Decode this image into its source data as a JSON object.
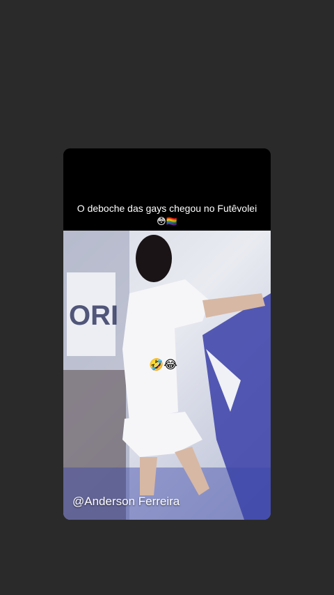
{
  "story": {
    "caption_line1": "O deboche das gays chegou no Futêvolei",
    "caption_line2": "😳🏳️‍🌈",
    "reaction_emoji": "🤣😂",
    "watermark": "@Anderson Ferreira"
  }
}
